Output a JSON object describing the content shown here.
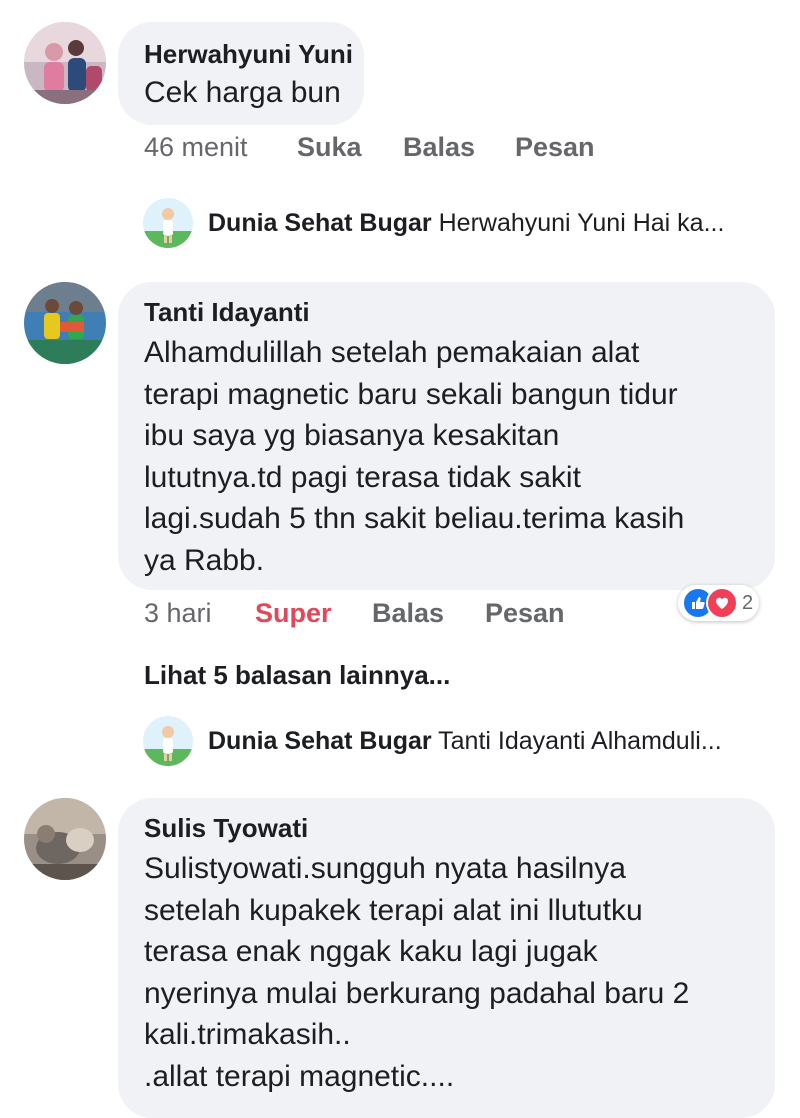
{
  "comments": [
    {
      "author": "Herwahyuni Yuni",
      "text": "Cek harga bun",
      "time": "46 menit",
      "reaction_label": "Suka",
      "reply_label": "Balas",
      "message_label": "Pesan",
      "reply_preview": {
        "author": "Dunia Sehat Bugar",
        "text": "Herwahyuni Yuni Hai ka..."
      }
    },
    {
      "author": "Tanti Idayanti",
      "text": "Alhamdulillah  setelah pemakaian  alat\nterapi magnetic baru sekali bangun tidur\nibu saya yg biasanya kesakitan\nlututnya.td pagi terasa tidak sakit\nlagi.sudah 5 thn sakit beliau.terima kasih\nya Rabb.",
      "time": "3 hari",
      "reaction_label": "Super",
      "reply_label": "Balas",
      "message_label": "Pesan",
      "reaction_count": "2",
      "reaction_icons": [
        "like-icon",
        "love-icon"
      ],
      "more_replies": "Lihat 5 balasan lainnya...",
      "reply_preview": {
        "author": "Dunia Sehat Bugar",
        "text": "Tanti Idayanti Alhamduli..."
      }
    },
    {
      "author": "Sulis Tyowati",
      "text": "Sulistyowati.sungguh  nyata hasilnya\nsetelah kupakek terapi  alat ini llututku\nterasa  enak nggak kaku lagi jugak\nnyerinya mulai berkurang padahal baru  2\nkali.trimakasih..\n.allat terapi magnetic...."
    }
  ],
  "colors": {
    "bubble": "#f0f2f5",
    "meta": "#65676b",
    "super": "#e4475a",
    "like": "#1877f2",
    "love": "#f33e58"
  }
}
